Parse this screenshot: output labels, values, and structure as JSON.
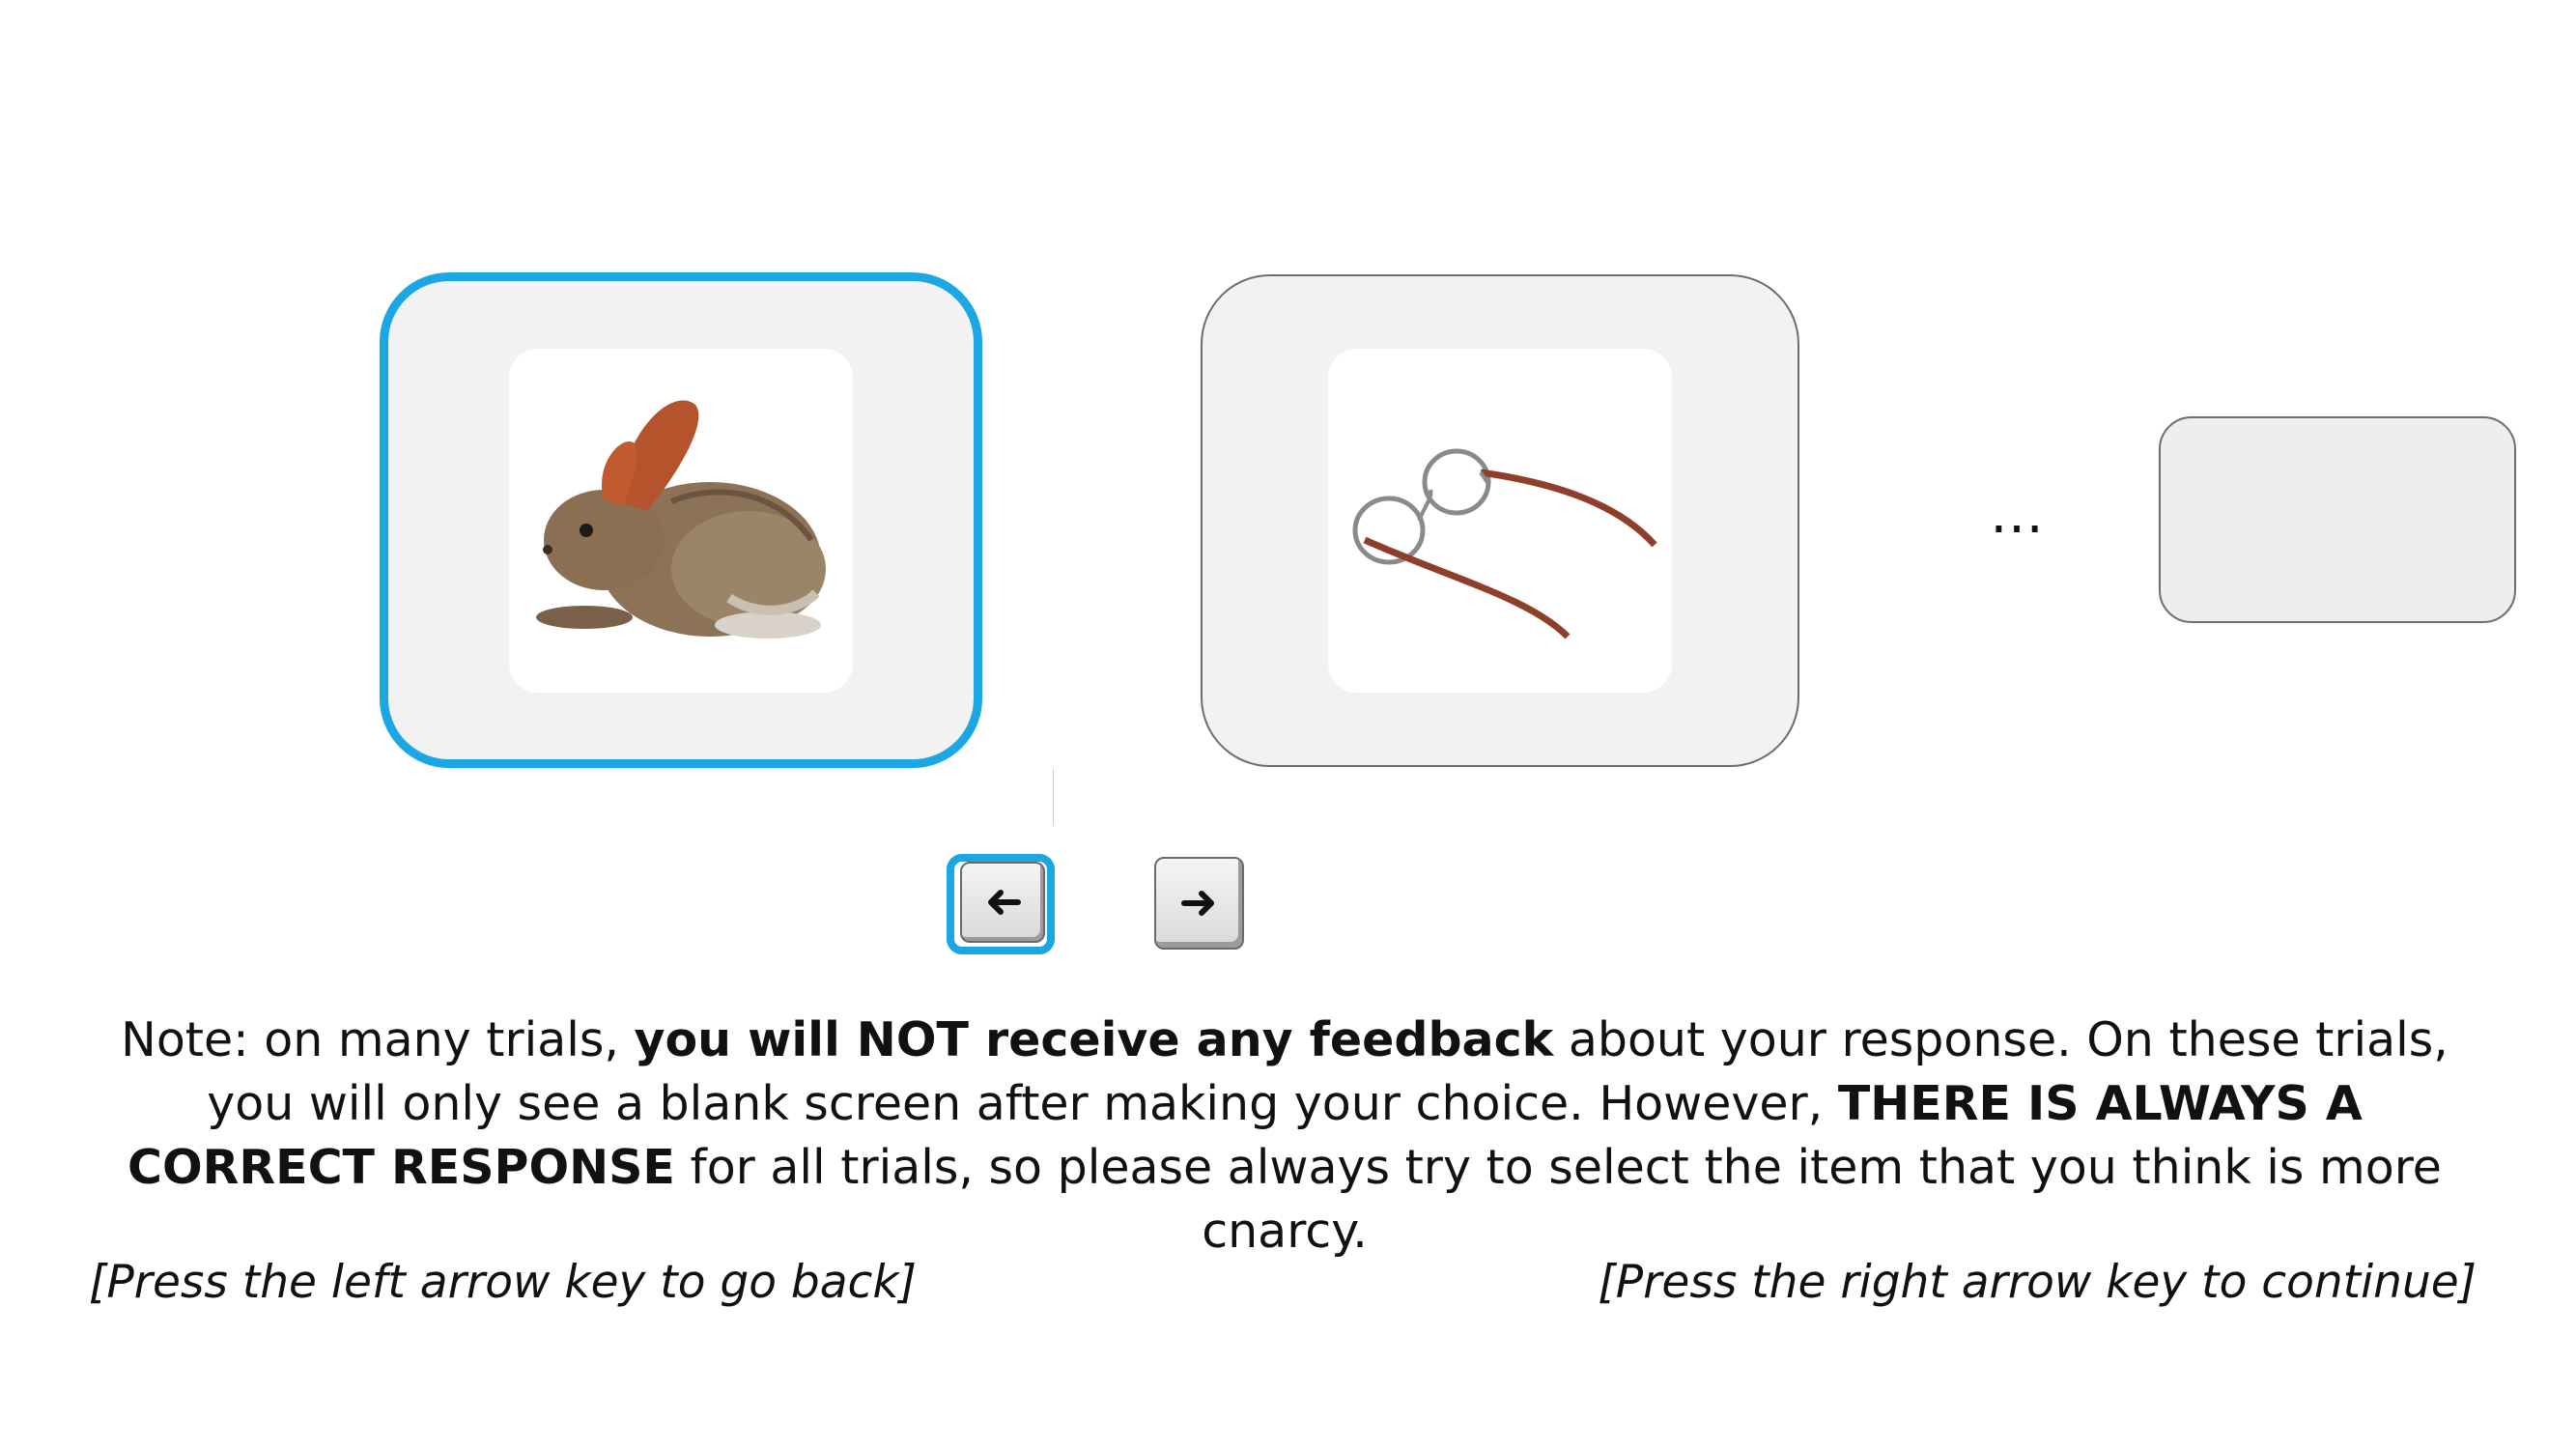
{
  "stimuli": {
    "left": {
      "name": "rabbit",
      "selected": true
    },
    "right": {
      "name": "eyeglasses",
      "selected": false
    },
    "more_indicator": "…"
  },
  "keys": {
    "left": {
      "icon": "arrow-left-icon",
      "selected": true
    },
    "right": {
      "icon": "arrow-right-icon",
      "selected": false
    }
  },
  "note": {
    "p1": "Note: on many trials, ",
    "b1": "you will NOT receive any feedback",
    "p2": " about your response. On these trials, you will only see a blank screen after making your choice. However, ",
    "b2": "THERE IS ALWAYS A CORRECT RESPONSE",
    "p3": " for all trials, so please always try to select the item that you think is more cnarcy."
  },
  "instructions": {
    "back": "[Press the left arrow key to go back]",
    "continue": "[Press the right arrow key to continue]"
  },
  "colors": {
    "selection": "#1aa7e3",
    "card_fill": "#f2f2f2",
    "card_border": "#6d6d6d"
  }
}
